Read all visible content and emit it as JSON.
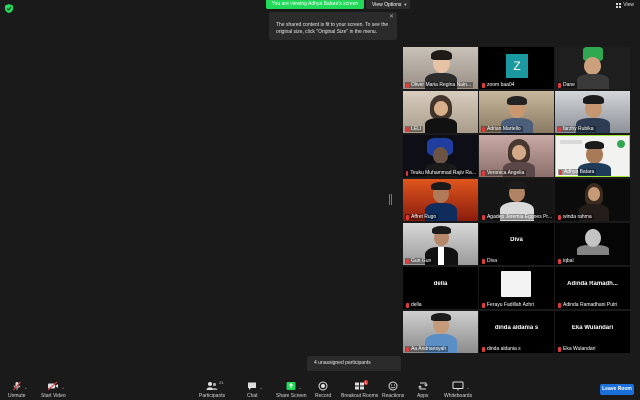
{
  "header": {
    "share_banner": "You are viewing Adhya Batara's screen",
    "view_options": "View Options",
    "view_button": "View"
  },
  "tooltip": {
    "text": "The shared content is fit to your screen. To see the\noriginal size, click \"Original Size\" in the menu."
  },
  "participants": [
    {
      "name": "Oliver Maria Regina Nain..."
    },
    {
      "name": "zoom baa04"
    },
    {
      "name": "Dane"
    },
    {
      "name": "LELI"
    },
    {
      "name": "Adrian Martello"
    },
    {
      "name": "farzhy Rubika"
    },
    {
      "name": "Teuku Muhammad Rajiv Ra..."
    },
    {
      "name": "Veronica Angelia"
    },
    {
      "name": "Adhya Batara"
    },
    {
      "name": "Affret Rugo"
    },
    {
      "name": "Agadep Jeremia Eggoes Pr..."
    },
    {
      "name": "winda rahma"
    },
    {
      "name": "Gun Gun"
    },
    {
      "name": "Diva",
      "display": "Diva"
    },
    {
      "name": "iqbal"
    },
    {
      "name": "della",
      "display": "della"
    },
    {
      "name": "Ferayu Fadillah Azhri"
    },
    {
      "name": "Adinda Ramadhani Putri",
      "display": "Adinda  Ramadh..."
    },
    {
      "name": "Aa Andriansyah"
    },
    {
      "name": "dinda aldania s",
      "display": "dinda aldania s"
    },
    {
      "name": "Eka Wulandari",
      "display": "Eka Wulandari"
    }
  ],
  "avatar_letter": "Z",
  "unassigned": "4 unassigned participants",
  "toolbar": {
    "unmute": "Unmute",
    "start_video": "Start Video",
    "participants": "Participants",
    "participants_count": "21",
    "chat": "Chat",
    "share_screen": "Share Screen",
    "record": "Record",
    "breakout_rooms": "Breakout Rooms",
    "reactions": "Reactions",
    "apps": "Apps",
    "whiteboards": "Whiteboards",
    "leave": "Leave Room"
  },
  "colors": {
    "share_green": "#23d959",
    "leave_blue": "#1a6fd8",
    "active_border": "#a3e635",
    "muted_red": "#e03c3c"
  }
}
